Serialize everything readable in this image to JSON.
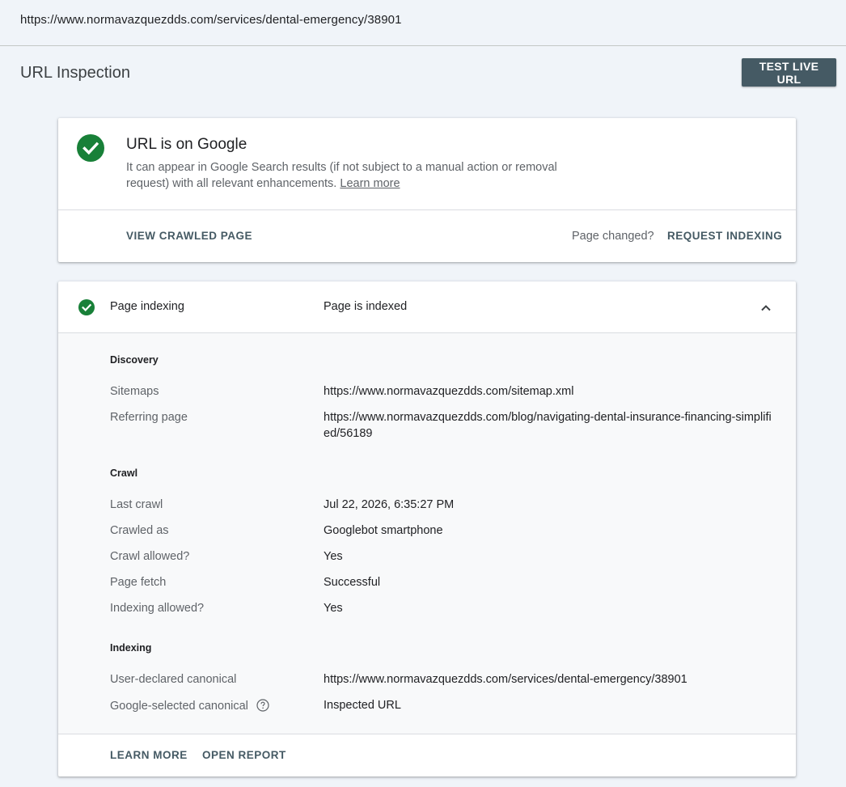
{
  "url_bar": {
    "url": "https://www.normavazquezdds.com/services/dental-emergency/38901"
  },
  "header": {
    "title": "URL Inspection",
    "test_live_button": "TEST LIVE URL"
  },
  "status_card": {
    "title": "URL is on Google",
    "description": "It can appear in Google Search results (if not subject to a manual action or removal request) with all relevant enhancements.",
    "learn_more_link": "Learn more",
    "view_crawled_button": "VIEW CRAWLED PAGE",
    "page_changed_text": "Page changed?",
    "request_indexing_button": "REQUEST INDEXING",
    "status_color": "#188038"
  },
  "indexing_card": {
    "label": "Page indexing",
    "value": "Page is indexed",
    "discovery": {
      "title": "Discovery",
      "sitemaps_label": "Sitemaps",
      "sitemaps_value": "https://www.normavazquezdds.com/sitemap.xml",
      "referring_label": "Referring page",
      "referring_value": "https://www.normavazquezdds.com/blog/navigating-dental-insurance-financing-simplified/56189"
    },
    "crawl": {
      "title": "Crawl",
      "last_crawl_label": "Last crawl",
      "last_crawl_value": "Jul 22, 2026, 6:35:27 PM",
      "crawled_as_label": "Crawled as",
      "crawled_as_value": "Googlebot smartphone",
      "crawl_allowed_label": "Crawl allowed?",
      "crawl_allowed_value": "Yes",
      "page_fetch_label": "Page fetch",
      "page_fetch_value": "Successful",
      "indexing_allowed_label": "Indexing allowed?",
      "indexing_allowed_value": "Yes"
    },
    "indexing": {
      "title": "Indexing",
      "user_canonical_label": "User-declared canonical",
      "user_canonical_value": "https://www.normavazquezdds.com/services/dental-emergency/38901",
      "google_canonical_label": "Google-selected canonical",
      "google_canonical_value": "Inspected URL"
    },
    "learn_more_button": "LEARN MORE",
    "open_report_button": "OPEN REPORT"
  }
}
